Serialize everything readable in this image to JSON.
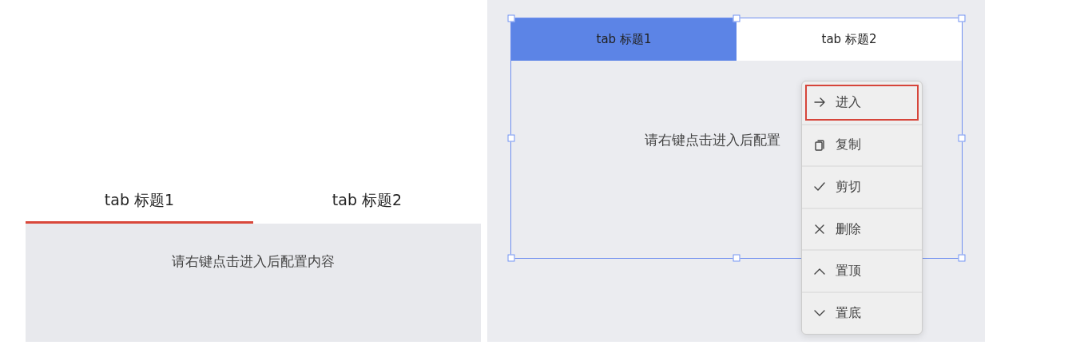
{
  "preview": {
    "tabs": [
      {
        "label": "tab 标题1",
        "selected": true
      },
      {
        "label": "tab 标题2",
        "selected": false
      }
    ],
    "content_text": "请右键点击进入后配置内容"
  },
  "editor": {
    "tabs": [
      {
        "label": "tab 标题1",
        "selected": true
      },
      {
        "label": "tab 标题2",
        "selected": false
      }
    ],
    "content_text": "请右键点击进入后配置",
    "context_menu": [
      {
        "kind": "enter",
        "label": "进入",
        "selected": true
      },
      {
        "kind": "copy",
        "label": "复制",
        "selected": false
      },
      {
        "kind": "cut",
        "label": "剪切",
        "selected": false
      },
      {
        "kind": "delete",
        "label": "删除",
        "selected": false
      },
      {
        "kind": "top",
        "label": "置顶",
        "selected": false
      },
      {
        "kind": "bottom",
        "label": "置底",
        "selected": false
      }
    ]
  }
}
